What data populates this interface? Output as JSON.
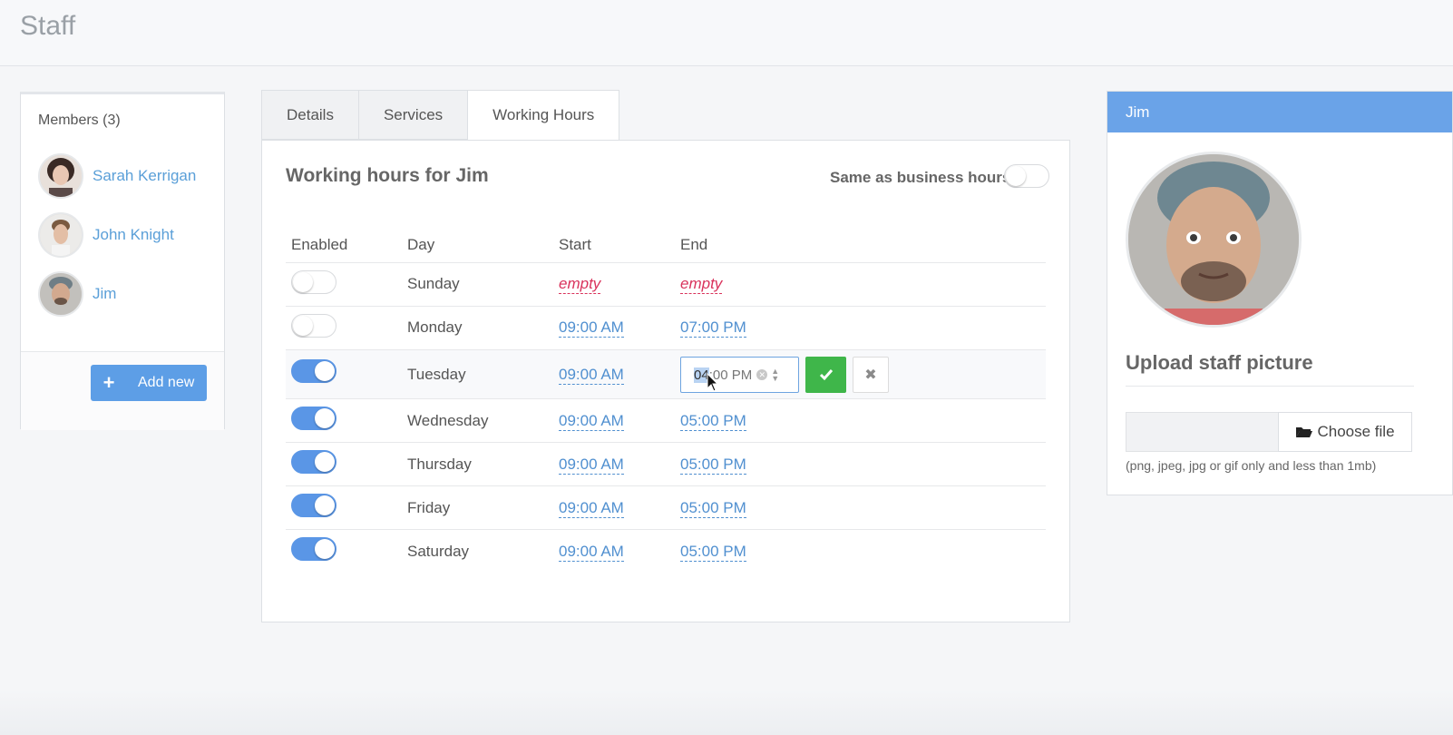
{
  "page": {
    "title": "Staff"
  },
  "members": {
    "title": "Members (3)",
    "list": [
      {
        "name": "Sarah Kerrigan"
      },
      {
        "name": "John Knight"
      },
      {
        "name": "Jim"
      }
    ],
    "add_label": "Add new",
    "add_icon": "+"
  },
  "tabs": [
    {
      "label": "Details"
    },
    {
      "label": "Services"
    },
    {
      "label": "Working Hours",
      "active": true
    }
  ],
  "working_hours": {
    "heading": "Working hours for Jim",
    "same_as_business": {
      "label": "Same as business hours",
      "on": false
    },
    "columns": {
      "enabled": "Enabled",
      "day": "Day",
      "start": "Start",
      "end": "End"
    },
    "rows": [
      {
        "enabled": false,
        "day": "Sunday",
        "start": "empty",
        "end": "empty"
      },
      {
        "enabled": false,
        "day": "Monday",
        "start": "09:00 AM",
        "end": "07:00 PM"
      },
      {
        "enabled": true,
        "day": "Tuesday",
        "start": "09:00 AM",
        "end": ""
      },
      {
        "enabled": true,
        "day": "Wednesday",
        "start": "09:00 AM",
        "end": "05:00 PM"
      },
      {
        "enabled": true,
        "day": "Thursday",
        "start": "09:00 AM",
        "end": "05:00 PM"
      },
      {
        "enabled": true,
        "day": "Friday",
        "start": "09:00 AM",
        "end": "05:00 PM"
      },
      {
        "enabled": true,
        "day": "Saturday",
        "start": "09:00 AM",
        "end": "05:00 PM"
      }
    ],
    "editor": {
      "hour_selected": "04",
      "rest": ":00 PM",
      "clear_icon": "x-circle-icon",
      "confirm_icon": "check-icon",
      "cancel_icon": "close-icon"
    }
  },
  "profile": {
    "name": "Jim",
    "upload_title": "Upload staff picture",
    "choose_label": "Choose file",
    "hint": "(png, jpeg, jpg or gif only and less than 1mb)"
  },
  "colors": {
    "accent": "#5a96e6",
    "header_blue": "#6aa3e8",
    "confirm_green": "#3fb64a",
    "empty_red": "#d9335c"
  }
}
